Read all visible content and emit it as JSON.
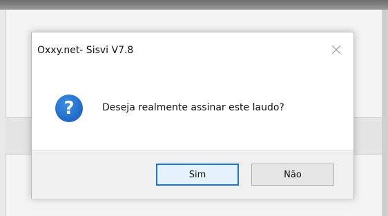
{
  "dialog": {
    "title": "Oxxy.net- Sisvi V7.8",
    "message": "Deseja realmente assinar este laudo?",
    "icon": "question-icon",
    "close_icon": "close-icon",
    "question_glyph": "?",
    "buttons": {
      "yes_label": "Sim",
      "no_label": "Não"
    },
    "accent_color": "#1a75d2"
  }
}
